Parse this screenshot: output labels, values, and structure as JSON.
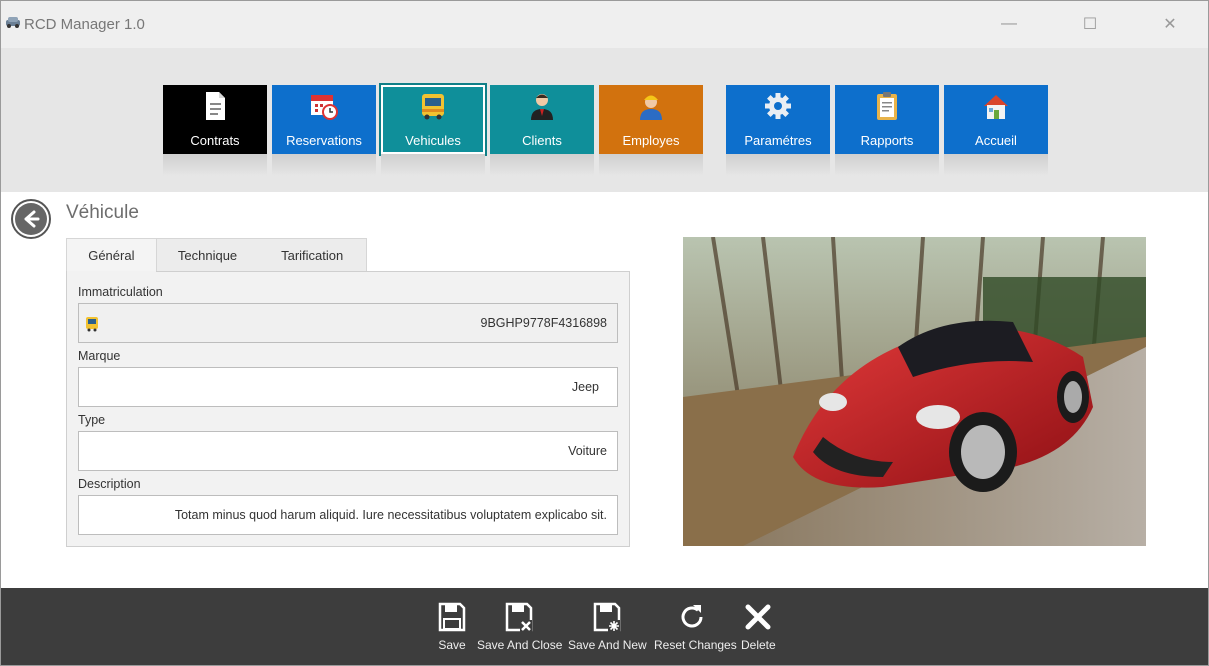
{
  "window": {
    "title": "RCD Manager 1.0",
    "controls": {
      "minimize": "—",
      "maximize": "☐",
      "close": "✕"
    }
  },
  "ribbon": {
    "tiles": [
      {
        "label": "Contrats",
        "icon": "document-icon",
        "color": "#000000"
      },
      {
        "label": "Reservations",
        "icon": "calendar-clock-icon",
        "color": "#0d6fcc"
      },
      {
        "label": "Vehicules",
        "icon": "bus-icon",
        "color": "#0f8f9a",
        "selected": true
      },
      {
        "label": "Clients",
        "icon": "person-icon",
        "color": "#0f8f9a"
      },
      {
        "label": "Employes",
        "icon": "worker-icon",
        "color": "#d2720e"
      },
      {
        "label": "Paramétres",
        "icon": "gear-icon",
        "color": "#0d6fcc"
      },
      {
        "label": "Rapports",
        "icon": "clipboard-icon",
        "color": "#0d6fcc"
      },
      {
        "label": "Accueil",
        "icon": "home-icon",
        "color": "#0d6fcc"
      }
    ]
  },
  "page": {
    "title": "Véhicule",
    "tabs": [
      {
        "label": "Général",
        "active": true
      },
      {
        "label": "Technique",
        "active": false
      },
      {
        "label": "Tarification",
        "active": false
      }
    ],
    "fields": {
      "immatriculation": {
        "label": "Immatriculation",
        "value": "9BGHP9778F4316898"
      },
      "marque": {
        "label": "Marque",
        "value": "Jeep"
      },
      "type": {
        "label": "Type",
        "value": "Voiture"
      },
      "description": {
        "label": "Description",
        "value": "Totam minus quod harum aliquid. Iure necessitatibus voluptatem explicabo sit."
      }
    }
  },
  "actions": [
    {
      "label": "Save",
      "icon": "floppy-icon"
    },
    {
      "label": "Save And Close",
      "icon": "floppy-close-icon"
    },
    {
      "label": "Save And New",
      "icon": "floppy-new-icon"
    },
    {
      "label": "Reset Changes",
      "icon": "reset-icon"
    },
    {
      "label": "Delete",
      "icon": "delete-icon"
    }
  ]
}
